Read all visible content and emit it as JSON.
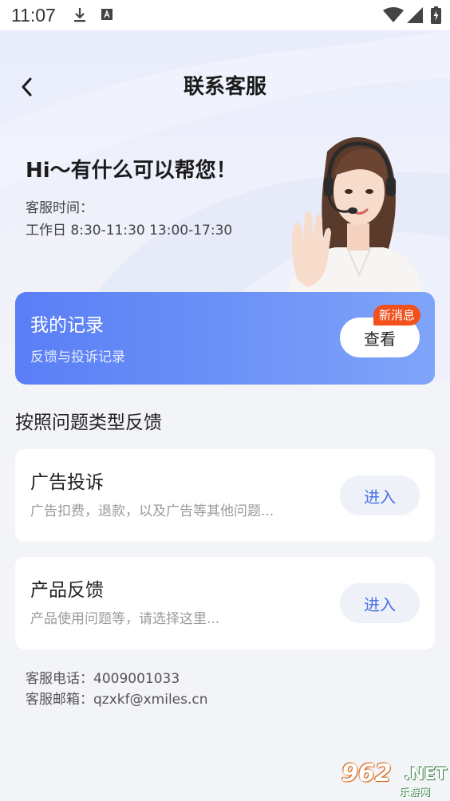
{
  "status_bar": {
    "time": "11:07",
    "icons": [
      "download-icon",
      "a-notification-icon",
      "wifi-icon",
      "signal-icon",
      "battery-icon"
    ]
  },
  "header": {
    "title": "联系客服",
    "back_icon": "chevron-left-icon"
  },
  "hero": {
    "greeting": "Hi～有什么可以帮您！",
    "hours_label": "客服时间：",
    "hours_value": "工作日 8:30-11:30 13:00-17:30",
    "illustration": "customer-service-agent-with-headset"
  },
  "record_card": {
    "title": "我的记录",
    "subtitle": "反馈与投诉记录",
    "view_label": "查看",
    "badge": "新消息"
  },
  "section_title": "按照问题类型反馈",
  "feedback_items": [
    {
      "title": "广告投诉",
      "description": "广告扣费，退款，以及广告等其他问题...",
      "button_label": "进入"
    },
    {
      "title": "产品反馈",
      "description": "产品使用问题等，请选择这里...",
      "button_label": "进入"
    }
  ],
  "contact": {
    "phone": "客服电话：4009001033",
    "email": "客服邮箱：qzxkf@xmiles.cn"
  },
  "watermark": {
    "number": "962",
    "suffix": ".NET",
    "subtitle": "乐游网"
  },
  "colors": {
    "accent": "#5a7ef6",
    "badge": "#f2511d",
    "enter_text": "#4a74e8",
    "background": "#f3f4f8"
  }
}
